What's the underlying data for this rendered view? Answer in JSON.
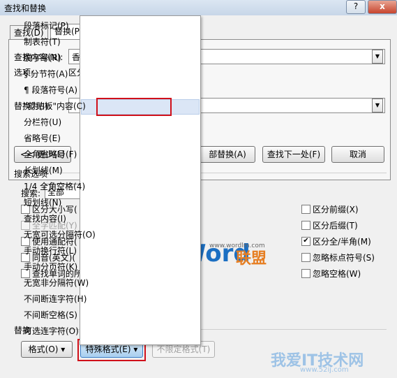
{
  "window": {
    "title": "查找和替换",
    "help": "?",
    "close": "x"
  },
  "tabs": [
    {
      "label": "查找(D)"
    },
    {
      "label": "替换(P"
    }
  ],
  "find": {
    "label": "查找内容(N):",
    "value": "香",
    "options_label": "选项:",
    "options_value": "区分"
  },
  "replace": {
    "label": "替换为(I):",
    "value": ""
  },
  "buttons": {
    "less": "<< 更少(L)",
    "replace_all": "部替换(A)",
    "find_next": "查找下一处(F)",
    "cancel": "取消"
  },
  "search_options": {
    "title": "搜索选项",
    "search_label": "搜索:",
    "search_value": "全部"
  },
  "left_checks": [
    {
      "label": "区分大小写(",
      "checked": false,
      "disabled": false
    },
    {
      "label": "全字匹配(Y)",
      "checked": false,
      "disabled": true
    },
    {
      "label": "使用通配符(",
      "checked": false,
      "disabled": false
    },
    {
      "label": "同音(英文)(",
      "checked": false,
      "disabled": false
    },
    {
      "label": "查找单词的所",
      "checked": false,
      "disabled": false
    }
  ],
  "right_checks": [
    {
      "label": "区分前缀(X)",
      "checked": false
    },
    {
      "label": "区分后缀(T)",
      "checked": false
    },
    {
      "label": "区分全/半角(M)",
      "checked": true
    },
    {
      "label": "忽略标点符号(S)",
      "checked": false
    },
    {
      "label": "忽略空格(W)",
      "checked": false
    }
  ],
  "replace_section": {
    "title": "替换",
    "format": "格式(O) ▾",
    "special": "特殊格式(E) ▾",
    "no_limit": "不限定格式(T)"
  },
  "menu_items": [
    "段落标记(P)",
    "制表符(T)",
    "脱字号(R)",
    "§ 分节符(A)",
    "¶ 段落符号(A)",
    "\"剪贴板\"内容(C)",
    "分栏符(U)",
    "省略号(E)",
    "全角省略号(F)",
    "长划线(M)",
    "1/4 全角空格(4)",
    "短划线(N)",
    "查找内容(I)",
    "无宽可选分隔符(O)",
    "手动换行符(L)",
    "手动分页符(K)",
    "无宽非分隔符(W)",
    "不间断连字符(H)",
    "不间断空格(S)",
    "可选连字符(O)"
  ],
  "highlighted_item": "\"剪贴板\"内容(C)",
  "watermark": {
    "word": "Word",
    "union": "联盟",
    "url": "www.wordlm.com",
    "site": "我爱IT技术网",
    "site_url": "www.52ij.com"
  }
}
